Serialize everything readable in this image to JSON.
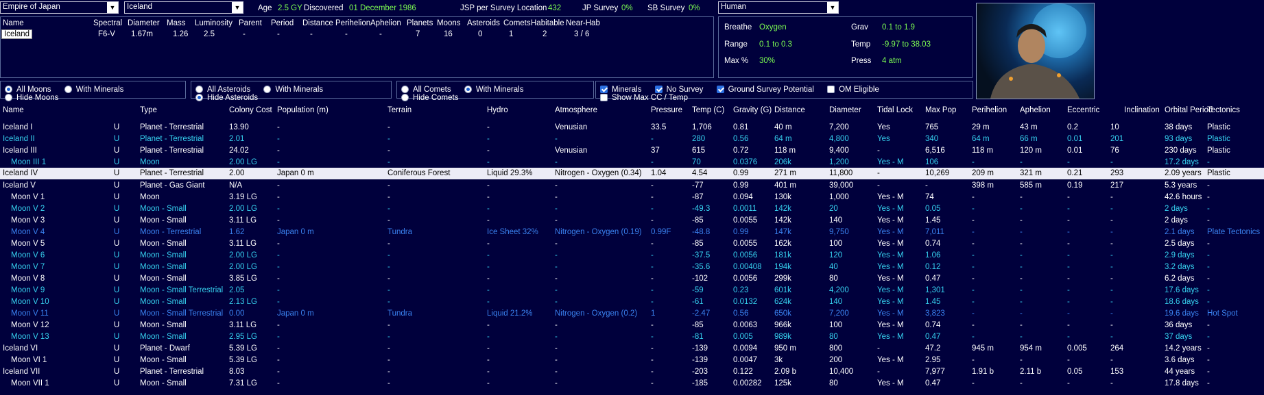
{
  "top": {
    "empire_select": "Empire of Japan",
    "system_select": "Iceland",
    "age_label": "Age",
    "age_value": "2.5 GY",
    "discovered_label": "Discovered",
    "discovered_value": "01 December 1986",
    "jsp_label": "JSP per Survey Location",
    "jsp_value": "432",
    "jp_label": "JP Survey",
    "jp_value": "0%",
    "sb_label": "SB Survey",
    "sb_value": "0%",
    "species_select": "Human"
  },
  "star_table": {
    "headers": [
      "Name",
      "Spectral",
      "Diameter",
      "Mass",
      "Luminosity",
      "Parent",
      "Period",
      "Distance",
      "Perihelion",
      "Aphelion",
      "Planets",
      "Moons",
      "Asteroids",
      "Comets",
      "Habitable",
      "Near-Hab"
    ],
    "values": [
      "Iceland",
      "F6-V",
      "1.67m",
      "1.26",
      "2.5",
      "-",
      "-",
      "-",
      "-",
      "-",
      "7",
      "16",
      "0",
      "1",
      "2",
      "3 / 6"
    ]
  },
  "env": {
    "breathe_label": "Breathe",
    "breathe_value": "Oxygen",
    "range_label": "Range",
    "range_value": "0.1  to  0.3",
    "max_label": "Max %",
    "max_value": "30%",
    "grav_label": "Grav",
    "grav_value": "0.1  to  1.9",
    "temp_label": "Temp",
    "temp_value": "-9.97  to  38.03",
    "press_label": "Press",
    "press_value": "4 atm"
  },
  "filters": {
    "moons": [
      "All Moons",
      "With Minerals",
      "Hide Moons"
    ],
    "asteroids": [
      "All Asteroids",
      "With Minerals",
      "Hide Asteroids"
    ],
    "comets": [
      "All Comets",
      "With Minerals",
      "Hide Comets"
    ],
    "checks": [
      "Minerals",
      "No Survey",
      "Ground Survey Potential",
      "OM Eligible",
      "Show Max CC / Temp"
    ]
  },
  "body_table": {
    "headers": [
      "Name",
      "Type",
      "Colony Cost",
      "Population (m)",
      "Terrain",
      "Hydro",
      "Atmosphere",
      "Pressure",
      "Temp (C)",
      "Gravity (G)",
      "Distance",
      "Diameter",
      "Tidal Lock",
      "Max Pop",
      "Perihelion",
      "Aphelion",
      "Eccentric",
      "Inclination",
      "Orbital Period",
      "Tectonics"
    ],
    "rows": [
      {
        "style": "white",
        "name": "Iceland I",
        "u": "U",
        "type": "Planet - Terrestrial",
        "cc": "13.90",
        "pop": "-",
        "terrain": "-",
        "hydro": "-",
        "atmo": "Venusian",
        "press": "33.5",
        "temp": "1,706",
        "grav": "0.81",
        "dist": "40 m",
        "diam": "7,200",
        "tidal": "Yes",
        "maxpop": "765",
        "peri": "29 m",
        "aph": "43 m",
        "ecc": "0.2",
        "inc": "10",
        "orb": "38 days",
        "tect": "Plastic"
      },
      {
        "style": "cyan",
        "name": "Iceland II",
        "u": "U",
        "type": "Planet - Terrestrial",
        "cc": "2.01",
        "pop": "-",
        "terrain": "-",
        "hydro": "-",
        "atmo": "-",
        "press": "-",
        "temp": "280",
        "grav": "0.56",
        "dist": "64 m",
        "diam": "4,800",
        "tidal": "Yes",
        "maxpop": "340",
        "peri": "64 m",
        "aph": "66 m",
        "ecc": "0.01",
        "inc": "201",
        "orb": "93 days",
        "tect": "Plastic"
      },
      {
        "style": "white",
        "name": "Iceland III",
        "u": "U",
        "type": "Planet - Terrestrial",
        "cc": "24.02",
        "pop": "-",
        "terrain": "-",
        "hydro": "-",
        "atmo": "Venusian",
        "press": "37",
        "temp": "615",
        "grav": "0.72",
        "dist": "118 m",
        "diam": "9,400",
        "tidal": "-",
        "maxpop": "6,516",
        "peri": "118 m",
        "aph": "120 m",
        "ecc": "0.01",
        "inc": "76",
        "orb": "230 days",
        "tect": "Plastic"
      },
      {
        "style": "cyan",
        "name": "Moon III 1",
        "u": "U",
        "type": "Moon",
        "cc": "2.00 LG",
        "pop": "-",
        "terrain": "-",
        "hydro": "-",
        "atmo": "-",
        "press": "-",
        "temp": "70",
        "grav": "0.0376",
        "dist": "206k",
        "diam": "1,200",
        "tidal": "Yes - M",
        "maxpop": "106",
        "peri": "-",
        "aph": "-",
        "ecc": "-",
        "inc": "-",
        "orb": "17.2 days",
        "tect": "-",
        "indent": true
      },
      {
        "style": "sel",
        "name": "Iceland IV",
        "u": "U",
        "type": "Planet - Terrestrial",
        "cc": "2.00",
        "pop": "Japan 0 m",
        "terrain": "Coniferous Forest",
        "hydro": "Liquid 29.3%",
        "atmo": "Nitrogen - Oxygen (0.34)",
        "press": "1.04",
        "temp": "4.54",
        "grav": "0.99",
        "dist": "271 m",
        "diam": "11,800",
        "tidal": "-",
        "maxpop": "10,269",
        "peri": "209 m",
        "aph": "321 m",
        "ecc": "0.21",
        "inc": "293",
        "orb": "2.09 years",
        "tect": "Plastic"
      },
      {
        "style": "white",
        "name": "Iceland V",
        "u": "U",
        "type": "Planet - Gas Giant",
        "cc": "N/A",
        "pop": "-",
        "terrain": "-",
        "hydro": "-",
        "atmo": "-",
        "press": "-",
        "temp": "-77",
        "grav": "0.99",
        "dist": "401 m",
        "diam": "39,000",
        "tidal": "-",
        "maxpop": "-",
        "peri": "398 m",
        "aph": "585 m",
        "ecc": "0.19",
        "inc": "217",
        "orb": "5.3 years",
        "tect": "-"
      },
      {
        "style": "white",
        "name": "Moon V 1",
        "u": "U",
        "type": "Moon",
        "cc": "3.19 LG",
        "pop": "-",
        "terrain": "-",
        "hydro": "-",
        "atmo": "-",
        "press": "-",
        "temp": "-87",
        "grav": "0.094",
        "dist": "130k",
        "diam": "1,000",
        "tidal": "Yes - M",
        "maxpop": "74",
        "peri": "-",
        "aph": "-",
        "ecc": "-",
        "inc": "-",
        "orb": "42.6 hours",
        "tect": "-",
        "indent": true
      },
      {
        "style": "cyan",
        "name": "Moon V 2",
        "u": "U",
        "type": "Moon - Small",
        "cc": "2.00 LG",
        "pop": "-",
        "terrain": "-",
        "hydro": "-",
        "atmo": "-",
        "press": "-",
        "temp": "-49.3",
        "grav": "0.0011",
        "dist": "142k",
        "diam": "20",
        "tidal": "Yes - M",
        "maxpop": "0.05",
        "peri": "-",
        "aph": "-",
        "ecc": "-",
        "inc": "-",
        "orb": "2 days",
        "tect": "-",
        "indent": true
      },
      {
        "style": "white",
        "name": "Moon V 3",
        "u": "U",
        "type": "Moon - Small",
        "cc": "3.11 LG",
        "pop": "-",
        "terrain": "-",
        "hydro": "-",
        "atmo": "-",
        "press": "-",
        "temp": "-85",
        "grav": "0.0055",
        "dist": "142k",
        "diam": "140",
        "tidal": "Yes - M",
        "maxpop": "1.45",
        "peri": "-",
        "aph": "-",
        "ecc": "-",
        "inc": "-",
        "orb": "2 days",
        "tect": "-",
        "indent": true
      },
      {
        "style": "blue",
        "name": "Moon V 4",
        "u": "U",
        "type": "Moon - Terrestrial",
        "cc": "1.62",
        "pop": "Japan 0 m",
        "terrain": "Tundra",
        "hydro": "Ice Sheet 32%",
        "atmo": "Nitrogen - Oxygen (0.19)",
        "press": "0.99F",
        "temp": "-48.8",
        "grav": "0.99",
        "dist": "147k",
        "diam": "9,750",
        "tidal": "Yes - M",
        "maxpop": "7,011",
        "peri": "-",
        "aph": "-",
        "ecc": "-",
        "inc": "-",
        "orb": "2.1 days",
        "tect": "Plate Tectonics",
        "indent": true
      },
      {
        "style": "white",
        "name": "Moon V 5",
        "u": "U",
        "type": "Moon - Small",
        "cc": "3.11 LG",
        "pop": "-",
        "terrain": "-",
        "hydro": "-",
        "atmo": "-",
        "press": "-",
        "temp": "-85",
        "grav": "0.0055",
        "dist": "162k",
        "diam": "100",
        "tidal": "Yes - M",
        "maxpop": "0.74",
        "peri": "-",
        "aph": "-",
        "ecc": "-",
        "inc": "-",
        "orb": "2.5 days",
        "tect": "-",
        "indent": true
      },
      {
        "style": "cyan",
        "name": "Moon V 6",
        "u": "U",
        "type": "Moon - Small",
        "cc": "2.00 LG",
        "pop": "-",
        "terrain": "-",
        "hydro": "-",
        "atmo": "-",
        "press": "-",
        "temp": "-37.5",
        "grav": "0.0056",
        "dist": "181k",
        "diam": "120",
        "tidal": "Yes - M",
        "maxpop": "1.06",
        "peri": "-",
        "aph": "-",
        "ecc": "-",
        "inc": "-",
        "orb": "2.9 days",
        "tect": "-",
        "indent": true
      },
      {
        "style": "cyan",
        "name": "Moon V 7",
        "u": "U",
        "type": "Moon - Small",
        "cc": "2.00 LG",
        "pop": "-",
        "terrain": "-",
        "hydro": "-",
        "atmo": "-",
        "press": "-",
        "temp": "-35.6",
        "grav": "0.00408",
        "dist": "194k",
        "diam": "40",
        "tidal": "Yes - M",
        "maxpop": "0.12",
        "peri": "-",
        "aph": "-",
        "ecc": "-",
        "inc": "-",
        "orb": "3.2 days",
        "tect": "-",
        "indent": true
      },
      {
        "style": "white",
        "name": "Moon V 8",
        "u": "U",
        "type": "Moon - Small",
        "cc": "3.85 LG",
        "pop": "-",
        "terrain": "-",
        "hydro": "-",
        "atmo": "-",
        "press": "-",
        "temp": "-102",
        "grav": "0.0056",
        "dist": "299k",
        "diam": "80",
        "tidal": "Yes - M",
        "maxpop": "0.47",
        "peri": "-",
        "aph": "-",
        "ecc": "-",
        "inc": "-",
        "orb": "6.2 days",
        "tect": "-",
        "indent": true
      },
      {
        "style": "cyan",
        "name": "Moon V 9",
        "u": "U",
        "type": "Moon - Small Terrestrial",
        "cc": "2.05",
        "pop": "-",
        "terrain": "-",
        "hydro": "-",
        "atmo": "-",
        "press": "-",
        "temp": "-59",
        "grav": "0.23",
        "dist": "601k",
        "diam": "4,200",
        "tidal": "Yes - M",
        "maxpop": "1,301",
        "peri": "-",
        "aph": "-",
        "ecc": "-",
        "inc": "-",
        "orb": "17.6 days",
        "tect": "-",
        "indent": true
      },
      {
        "style": "cyan",
        "name": "Moon V 10",
        "u": "U",
        "type": "Moon - Small",
        "cc": "2.13 LG",
        "pop": "-",
        "terrain": "-",
        "hydro": "-",
        "atmo": "-",
        "press": "-",
        "temp": "-61",
        "grav": "0.0132",
        "dist": "624k",
        "diam": "140",
        "tidal": "Yes - M",
        "maxpop": "1.45",
        "peri": "-",
        "aph": "-",
        "ecc": "-",
        "inc": "-",
        "orb": "18.6 days",
        "tect": "-",
        "indent": true
      },
      {
        "style": "blue",
        "name": "Moon V 11",
        "u": "U",
        "type": "Moon - Small Terrestrial",
        "cc": "0.00",
        "pop": "Japan 0 m",
        "terrain": "Tundra",
        "hydro": "Liquid 21.2%",
        "atmo": "Nitrogen - Oxygen (0.2)",
        "press": "1",
        "temp": "-2.47",
        "grav": "0.56",
        "dist": "650k",
        "diam": "7,200",
        "tidal": "Yes - M",
        "maxpop": "3,823",
        "peri": "-",
        "aph": "-",
        "ecc": "-",
        "inc": "-",
        "orb": "19.6 days",
        "tect": "Hot Spot",
        "indent": true
      },
      {
        "style": "white",
        "name": "Moon V 12",
        "u": "U",
        "type": "Moon - Small",
        "cc": "3.11 LG",
        "pop": "-",
        "terrain": "-",
        "hydro": "-",
        "atmo": "-",
        "press": "-",
        "temp": "-85",
        "grav": "0.0063",
        "dist": "966k",
        "diam": "100",
        "tidal": "Yes - M",
        "maxpop": "0.74",
        "peri": "-",
        "aph": "-",
        "ecc": "-",
        "inc": "-",
        "orb": "36 days",
        "tect": "-",
        "indent": true
      },
      {
        "style": "cyan",
        "name": "Moon V 13",
        "u": "U",
        "type": "Moon - Small",
        "cc": "2.95 LG",
        "pop": "-",
        "terrain": "-",
        "hydro": "-",
        "atmo": "-",
        "press": "-",
        "temp": "-81",
        "grav": "0.005",
        "dist": "989k",
        "diam": "80",
        "tidal": "Yes - M",
        "maxpop": "0.47",
        "peri": "-",
        "aph": "-",
        "ecc": "-",
        "inc": "-",
        "orb": "37 days",
        "tect": "-",
        "indent": true
      },
      {
        "style": "white",
        "name": "Iceland VI",
        "u": "U",
        "type": "Planet - Dwarf",
        "cc": "5.39 LG",
        "pop": "-",
        "terrain": "-",
        "hydro": "-",
        "atmo": "-",
        "press": "-",
        "temp": "-139",
        "grav": "0.0094",
        "dist": "950 m",
        "diam": "800",
        "tidal": "-",
        "maxpop": "47.2",
        "peri": "945 m",
        "aph": "954 m",
        "ecc": "0.005",
        "inc": "264",
        "orb": "14.2 years",
        "tect": "-"
      },
      {
        "style": "white",
        "name": "Moon VI 1",
        "u": "U",
        "type": "Moon - Small",
        "cc": "5.39 LG",
        "pop": "-",
        "terrain": "-",
        "hydro": "-",
        "atmo": "-",
        "press": "-",
        "temp": "-139",
        "grav": "0.0047",
        "dist": "3k",
        "diam": "200",
        "tidal": "Yes - M",
        "maxpop": "2.95",
        "peri": "-",
        "aph": "-",
        "ecc": "-",
        "inc": "-",
        "orb": "3.6 days",
        "tect": "-",
        "indent": true
      },
      {
        "style": "white",
        "name": "Iceland VII",
        "u": "U",
        "type": "Planet - Terrestrial",
        "cc": "8.03",
        "pop": "-",
        "terrain": "-",
        "hydro": "-",
        "atmo": "-",
        "press": "-",
        "temp": "-203",
        "grav": "0.122",
        "dist": "2.09 b",
        "diam": "10,400",
        "tidal": "-",
        "maxpop": "7,977",
        "peri": "1.91 b",
        "aph": "2.11 b",
        "ecc": "0.05",
        "inc": "153",
        "orb": "44 years",
        "tect": "-"
      },
      {
        "style": "white",
        "name": "Moon VII 1",
        "u": "U",
        "type": "Moon - Small",
        "cc": "7.31 LG",
        "pop": "-",
        "terrain": "-",
        "hydro": "-",
        "atmo": "-",
        "press": "-",
        "temp": "-185",
        "grav": "0.00282",
        "dist": "125k",
        "diam": "80",
        "tidal": "Yes - M",
        "maxpop": "0.47",
        "peri": "-",
        "aph": "-",
        "ecc": "-",
        "inc": "-",
        "orb": "17.8 days",
        "tect": "-",
        "indent": true
      }
    ]
  }
}
